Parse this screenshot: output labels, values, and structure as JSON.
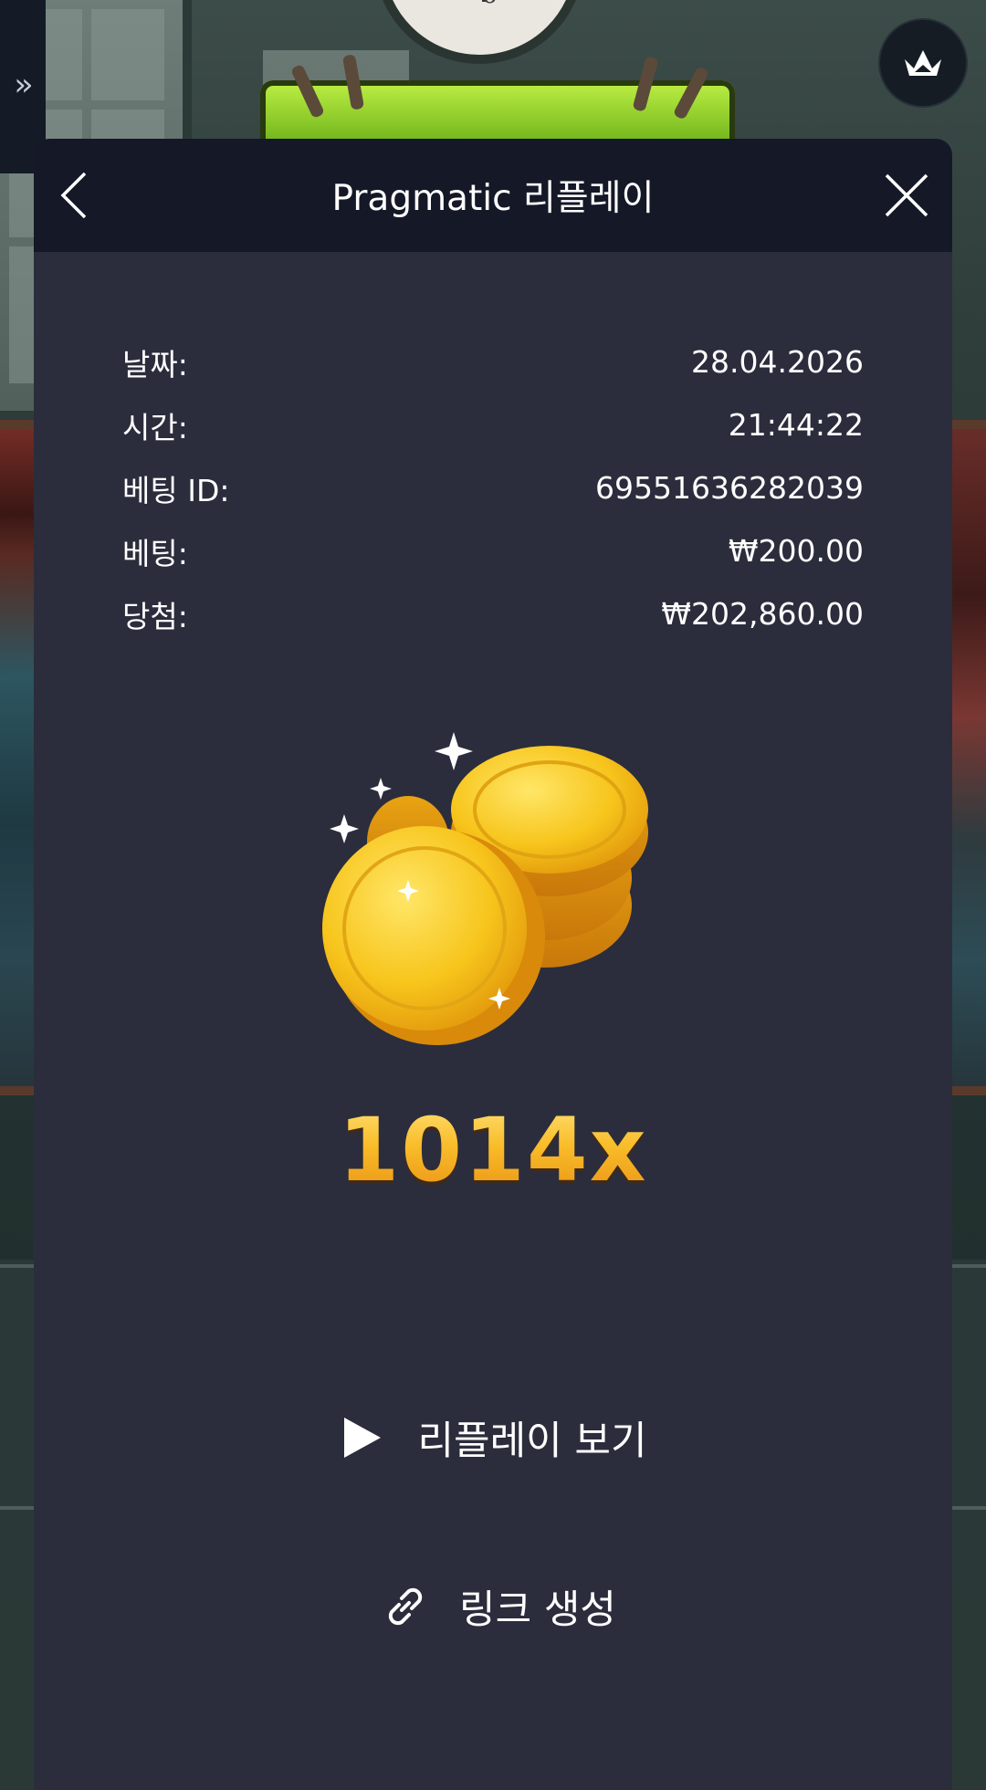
{
  "app": {
    "side_toggle_icon": "double-chevron-right-icon",
    "crown_icon": "crown-icon"
  },
  "modal": {
    "title": "Pragmatic 리플레이",
    "back_icon": "chevron-left-icon",
    "close_icon": "close-icon",
    "rows": [
      {
        "label": "날짜:",
        "value": "28.04.2026"
      },
      {
        "label": "시간:",
        "value": "21:44:22"
      },
      {
        "label": "베팅 ID:",
        "value": "69551636282039"
      },
      {
        "label": "베팅:",
        "value": "₩200.00"
      },
      {
        "label": "당첨:",
        "value": "₩202,860.00"
      }
    ],
    "coins_icon": "gold-coins-icon",
    "multiplier": "1014x",
    "replay_button_label": "리플레이 보기",
    "replay_icon": "play-icon",
    "link_button_label": "링크 생성",
    "link_icon": "link-icon"
  },
  "colors": {
    "modal_bg": "#2b2d3c",
    "header_bg": "#151827",
    "text": "#ffffff",
    "gold": "#f6a823"
  }
}
